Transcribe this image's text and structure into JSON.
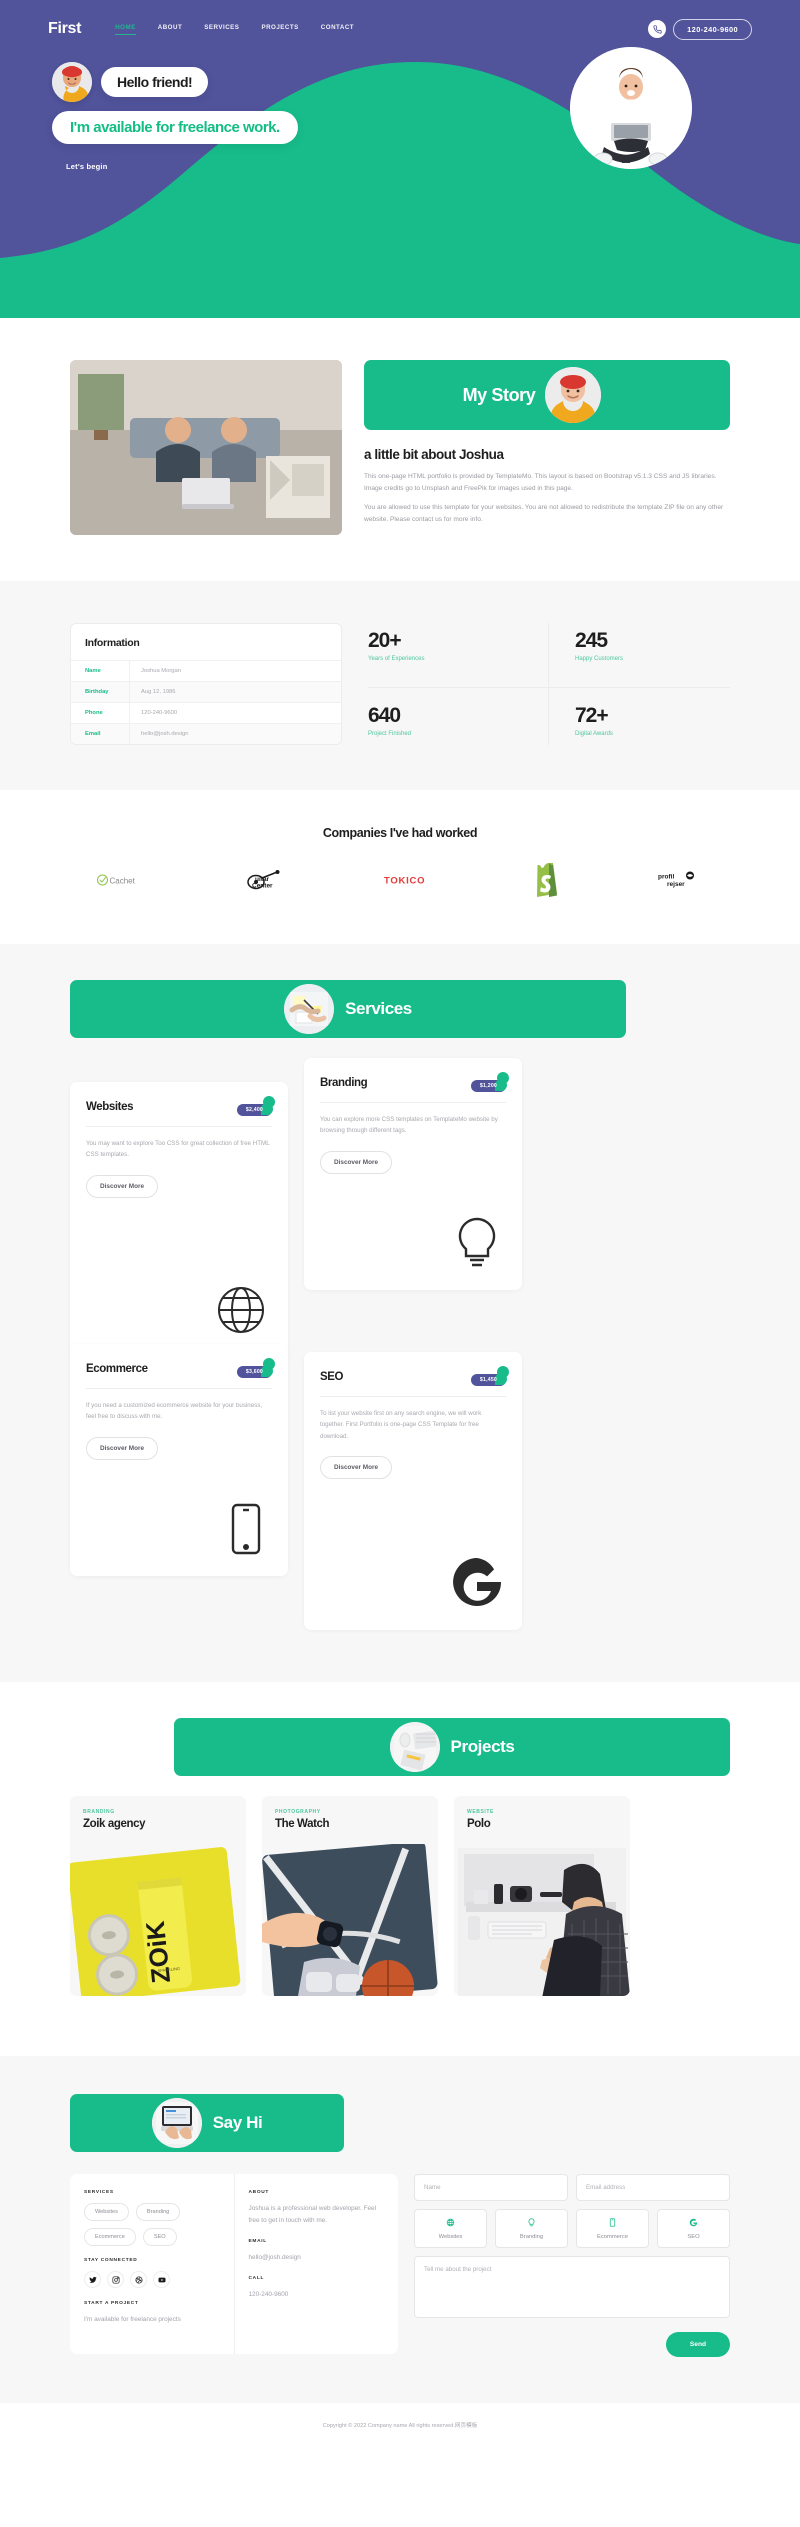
{
  "header": {
    "brand": "First",
    "nav": [
      {
        "label": "HOME",
        "active": true
      },
      {
        "label": "ABOUT",
        "active": false
      },
      {
        "label": "SERVICES",
        "active": false
      },
      {
        "label": "PROJECTS",
        "active": false
      },
      {
        "label": "CONTACT",
        "active": false
      }
    ],
    "phone_icon": "phone-icon",
    "phone": "120-240-9600"
  },
  "hero": {
    "greeting": "Hello friend!",
    "headline": "I'm available for freelance work.",
    "cta": "Let's begin",
    "avatar_alt": "profile-photo",
    "photo_alt": "man-with-laptop-photo"
  },
  "about": {
    "image_alt": "couple-on-sofa-with-laptop",
    "card_title": "My Story",
    "card_avatar_alt": "joshua-avatar",
    "heading": "a little bit about Joshua",
    "paragraphs": [
      "This one-page HTML portfolio is provided by TemplateMo. This layout is based on Bootstrap v5.1.3 CSS and JS libraries. Image credits go to Unsplash and FreePik for images used in this page.",
      "You are allowed to use this template for your websites. You are not allowed to redistribute the template ZIP file on any other website. Please contact us for more info."
    ]
  },
  "information": {
    "title": "Information",
    "rows": [
      {
        "key": "Name",
        "value": "Joshua Morgan"
      },
      {
        "key": "Birthday",
        "value": "Aug 12, 1986"
      },
      {
        "key": "Phone",
        "value": "120-240-9600"
      },
      {
        "key": "Email",
        "value": "hello@josh.design"
      }
    ]
  },
  "stats": [
    {
      "number": "20+",
      "label": "Years of Experiences"
    },
    {
      "number": "245",
      "label": "Happy Customers"
    },
    {
      "number": "640",
      "label": "Project Finished"
    },
    {
      "number": "72+",
      "label": "Digital Awards"
    }
  ],
  "companies": {
    "heading": "Companies I've had worked",
    "logos": [
      {
        "name": "Cachet",
        "icon": "cachet-logo"
      },
      {
        "name": "Guitar Center",
        "icon": "guitar-center-logo"
      },
      {
        "name": "TOKICO",
        "icon": "tokico-logo"
      },
      {
        "name": "Shopify",
        "icon": "shopify-logo"
      },
      {
        "name": "profil rejser",
        "icon": "profil-rejser-logo"
      }
    ]
  },
  "services": {
    "banner_title": "Services",
    "banner_avatar_alt": "handshake-photo",
    "discover_label": "Discover More",
    "items": [
      {
        "title": "Websites",
        "price": "$2,400",
        "text": "You may want to explore Too CSS for great collection of free HTML CSS templates.",
        "icon": "globe-icon"
      },
      {
        "title": "Branding",
        "price": "$1,200",
        "text": "You can explore more CSS templates on TemplateMo website by browsing through different tags.",
        "icon": "lightbulb-icon"
      },
      {
        "title": "Ecommerce",
        "price": "$3,600",
        "text": "If you need a customized ecommerce website for your business, feel free to discuss with me.",
        "icon": "mobile-icon"
      },
      {
        "title": "SEO",
        "price": "$1,450",
        "text": "To list your website first on any search engine, we will work together. First Portfolio is one-page CSS Template for free download.",
        "icon": "google-icon"
      }
    ]
  },
  "projects": {
    "banner_title": "Projects",
    "banner_avatar_alt": "desk-keyboard-photo",
    "items": [
      {
        "category": "BRANDING",
        "title": "Zoik agency",
        "image_alt": "zoik-cans-yellow"
      },
      {
        "category": "PHOTOGRAPHY",
        "title": "The Watch",
        "image_alt": "watch-on-court"
      },
      {
        "category": "WEBSITE",
        "title": "Polo",
        "image_alt": "man-at-desk"
      }
    ]
  },
  "contact": {
    "banner_title": "Say Hi",
    "banner_avatar_alt": "hands-on-laptop-photo",
    "services_label": "SERVICES",
    "service_tags": [
      "Websites",
      "Branding",
      "Ecommerce",
      "SEO"
    ],
    "stay_connected_label": "STAY CONNECTED",
    "socials": [
      {
        "name": "twitter-icon",
        "glyph": "𝕏"
      },
      {
        "name": "instagram-icon",
        "glyph": "▢"
      },
      {
        "name": "dribbble-icon",
        "glyph": "◎"
      },
      {
        "name": "youtube-icon",
        "glyph": "▶"
      }
    ],
    "start_project_label": "START A PROJECT",
    "start_project_text": "I'm available for freelance projects",
    "about_label": "ABOUT",
    "about_text": "Joshua is a professional web developer. Feel free to get in touch with me.",
    "email_label": "EMAIL",
    "email_value": "hello@josh.design",
    "call_label": "CALL",
    "call_value": "120-240-9600",
    "form": {
      "name_placeholder": "Name",
      "email_placeholder": "Email address",
      "message_placeholder": "Tell me about the project",
      "picks": [
        {
          "label": "Websites",
          "icon": "globe-icon"
        },
        {
          "label": "Branding",
          "icon": "lightbulb-icon"
        },
        {
          "label": "Ecommerce",
          "icon": "mobile-icon"
        },
        {
          "label": "SEO",
          "icon": "google-icon"
        }
      ],
      "send_label": "Send"
    }
  },
  "footer": {
    "copyright": "Copyright © 2022 Company name All rights reserved.",
    "link": "网页模板"
  },
  "colors": {
    "purple": "#51539b",
    "green": "#17bc8a",
    "green_light": "#4dc79e",
    "gray_bg": "#f7f7f7"
  }
}
